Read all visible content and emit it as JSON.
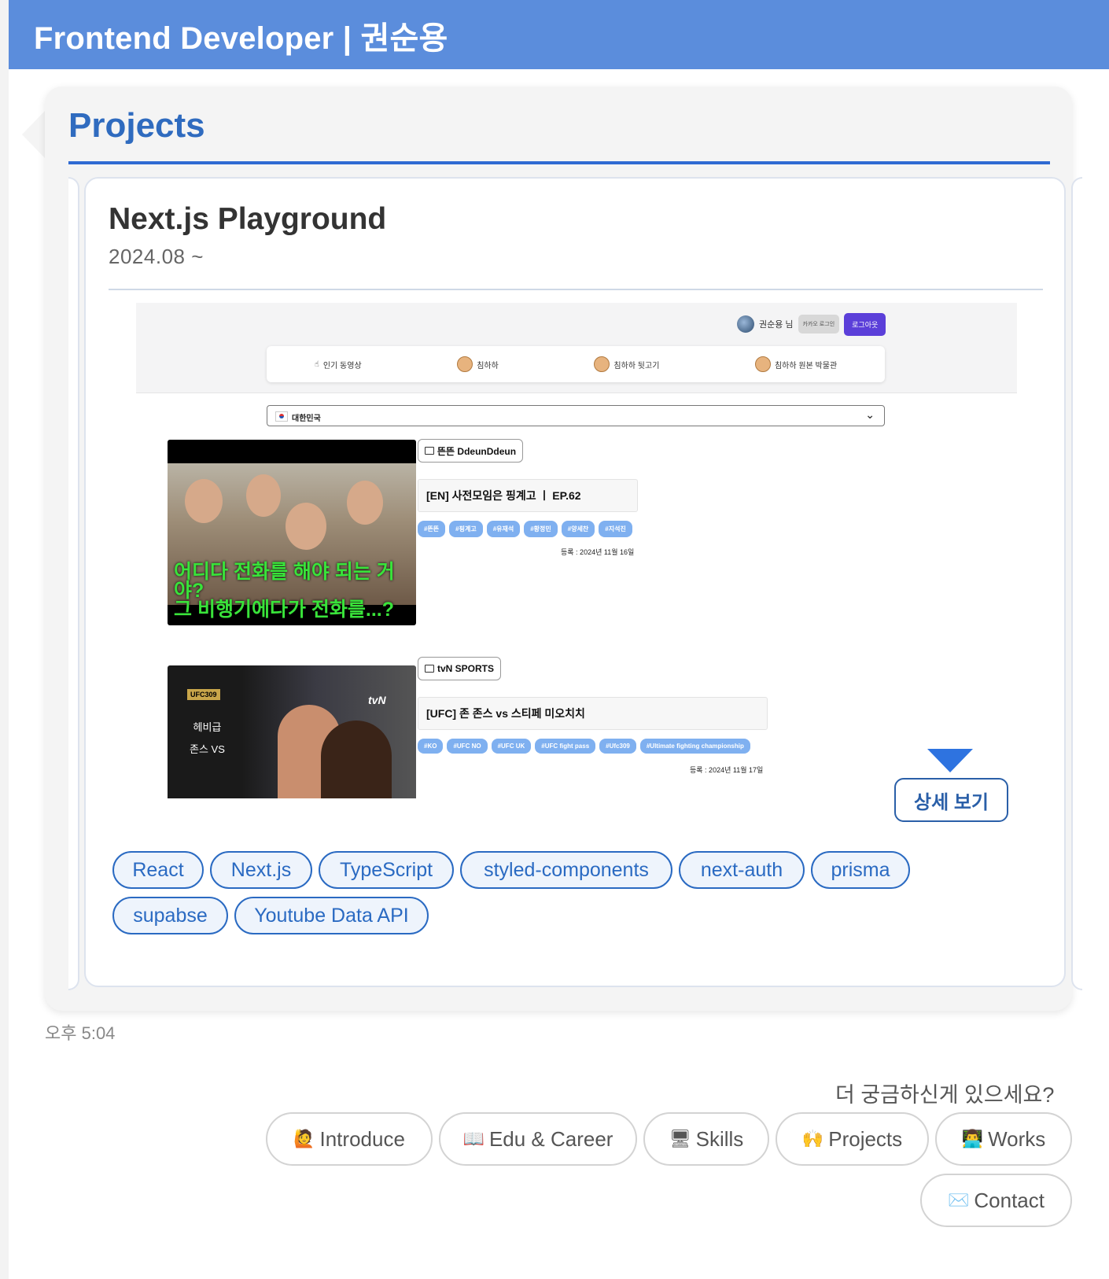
{
  "header": {
    "title": "Frontend Developer | 권순용"
  },
  "section": {
    "title": "Projects"
  },
  "project": {
    "title": "Next.js Playground",
    "date": "2024.08 ~",
    "preview": {
      "user_name": "권순용 님",
      "kakao_label": "카카오 로그인",
      "logout_label": "로그아웃",
      "nav": [
        "인기 동영상",
        "침하하",
        "침하하 뒷고기",
        "침하하 원본 박물관"
      ],
      "country_select": "대한민국",
      "videos": [
        {
          "channel": "뜬뜬 DdeunDdeun",
          "title": "[EN] 사전모임은 핑계고 ㅣ EP.62",
          "tags": [
            "#뜬뜬",
            "#핑계고",
            "#유재석",
            "#황정민",
            "#양세찬",
            "#지석진"
          ],
          "registered": "등록 : 2024년 11월 16일",
          "thumb_caption_1": "어디다 전화를 해야 되는 거야?",
          "thumb_caption_2": "그 비행기에다가 전화를...?"
        },
        {
          "channel": "tvN SPORTS",
          "title": "[UFC] 존 존스 vs 스티페 미오치치",
          "tags": [
            "#KO",
            "#UFC NO",
            "#UFC UK",
            "#UFC fight pass",
            "#Ufc309",
            "#Ultimate fighting championship"
          ],
          "registered": "등록 : 2024년 11월 17일",
          "thumb_ufc": "UFC309",
          "thumb_weight": "헤비급",
          "thumb_vs": "존스 VS",
          "thumb_tvn": "tvN"
        }
      ]
    },
    "detail_button": "상세 보기",
    "skills": [
      "React",
      "Next.js",
      "TypeScript",
      "styled-components",
      "next-auth",
      "prisma",
      "supabse",
      "Youtube Data API"
    ]
  },
  "message_time": "오후 5:04",
  "followup": {
    "question": "더 궁금하신게 있으세요?",
    "buttons": [
      {
        "icon": "🙋",
        "label": "Introduce"
      },
      {
        "icon": "📖",
        "label": "Edu & Career"
      },
      {
        "icon": "🖥",
        "label": "Skills"
      },
      {
        "icon": "🙌",
        "label": "Projects"
      },
      {
        "icon": "👨‍💻",
        "label": "Works"
      },
      {
        "icon": "✉️",
        "label": "Contact"
      }
    ]
  },
  "colors": {
    "header_bg": "#5b8ddc",
    "accent": "#2f6bbf",
    "tag_bg": "#7fb0f0",
    "logout_bg": "#5b3fd9"
  }
}
